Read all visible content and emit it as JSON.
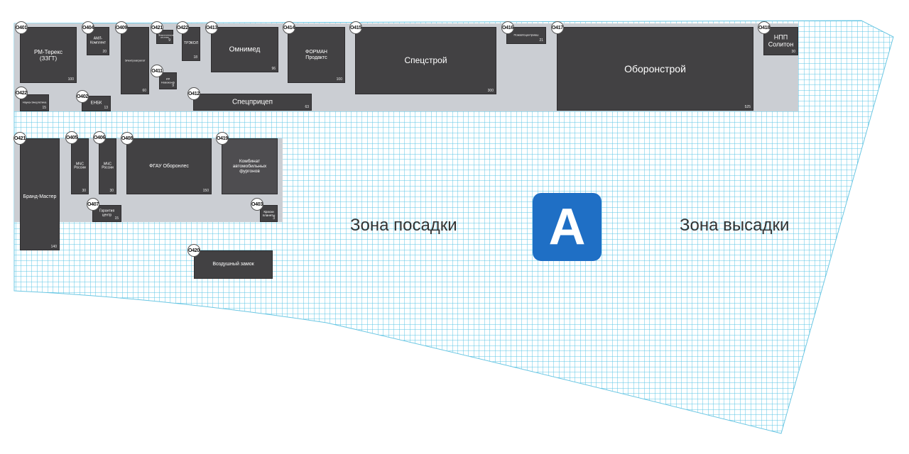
{
  "map": {
    "grid_color": "#5bc6e6",
    "platform_color": "#cbced3",
    "booth_color": "#424143",
    "zone_badge_letter": "A",
    "zone_badge_color": "#1f6fc5",
    "zone_boarding": "Зона посадки",
    "zone_dropoff": "Зона высадки"
  },
  "booths": [
    {
      "id": "O401",
      "name": "РМ-Терекс\n(ЗЗГТ)",
      "area": "100"
    },
    {
      "id": "O404",
      "name": "АМЛ-\nКомплект",
      "area": "20"
    },
    {
      "id": "O409",
      "name": "Электроагрегат",
      "area": "60"
    },
    {
      "id": "O421",
      "name": "Энергетические\nсистемы",
      "area": "9"
    },
    {
      "id": "O422",
      "name": "ТРЭКОЛ",
      "area": "18"
    },
    {
      "id": "O413",
      "name": "Омнимед",
      "area": "96"
    },
    {
      "id": "O414",
      "name": "ФОРМАН\nПродактс",
      "area": "100"
    },
    {
      "id": "O415",
      "name": "Спецстрой",
      "area": "300"
    },
    {
      "id": "O416",
      "name": "Пожавтоцентрмаш",
      "area": "21"
    },
    {
      "id": "O417",
      "name": "Оборонстрой",
      "area": "525"
    },
    {
      "id": "O418",
      "name": "НПП\nСолитон",
      "area": "30"
    },
    {
      "id": "O411",
      "name": "ИЛ\nНовоконф",
      "area": "9"
    },
    {
      "id": "O422",
      "name": "Наука-Энергетика",
      "area": "15"
    },
    {
      "id": "O402",
      "name": "ЕНБК",
      "area": "13"
    },
    {
      "id": "O412",
      "name": "Спецприцеп",
      "area": "63"
    },
    {
      "id": "O421",
      "name": "Бранд-Мастер",
      "area": "140"
    },
    {
      "id": "O405",
      "name": "МЧС\nРоссии",
      "area": "30"
    },
    {
      "id": "O406",
      "name": "МЧС\nРоссии",
      "area": "30"
    },
    {
      "id": "O408",
      "name": "ФГАУ Оборонлес",
      "area": "150"
    },
    {
      "id": "O419",
      "name": "Комбинат\nавтомобильных\nфургонов",
      "area": ""
    },
    {
      "id": "O407",
      "name": "Гарантия\nцентр",
      "area": "15"
    },
    {
      "id": "O403",
      "name": "Краски\nпланеты",
      "area": "3"
    },
    {
      "id": "O420",
      "name": "Воздушный замок",
      "area": ""
    }
  ]
}
